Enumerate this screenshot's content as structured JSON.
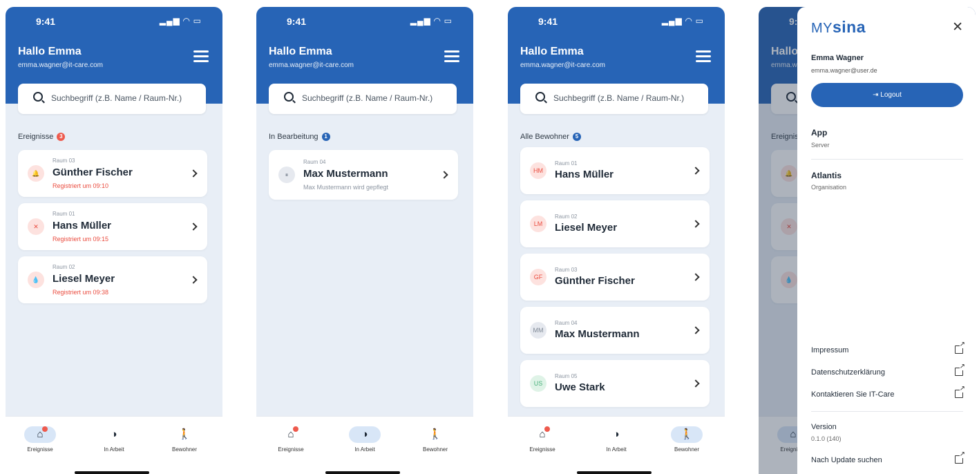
{
  "status": {
    "time": "9:41",
    "system_icons": "signal-wifi-battery"
  },
  "header": {
    "greeting": "Hallo Emma",
    "email": "emma.wagner@it-care.com",
    "menu_icon": "hamburger-menu-icon"
  },
  "search": {
    "placeholder": "Suchbegriff (z.B. Name / Raum-Nr.)"
  },
  "colors": {
    "primary": "#2764b6",
    "alert": "#ea4c3f",
    "background": "#e8eef6"
  },
  "screens": [
    {
      "section_title": "Ereignisse",
      "section_count": "3",
      "cards": [
        {
          "room": "Raum 03",
          "name": "Günther Fischer",
          "sub": "Registriert um 09:10",
          "icon": "alarm-bell-icon"
        },
        {
          "room": "Raum 01",
          "name": "Hans Müller",
          "sub": "Registriert um 09:15",
          "icon": "fall-person-icon"
        },
        {
          "room": "Raum 02",
          "name": "Liesel Meyer",
          "sub": "Registriert um 09:38",
          "icon": "water-drop-icon"
        }
      ]
    },
    {
      "section_title": "In Bearbeitung",
      "section_count": "1",
      "cards": [
        {
          "room": "Raum 04",
          "name": "Max Mustermann",
          "sub": "Max Mustermann wird gepflegt",
          "icon": "pause-icon"
        }
      ]
    },
    {
      "section_title": "Alle Bewohner",
      "section_count": "5",
      "cards": [
        {
          "room": "Raum 01",
          "name": "Hans Müller",
          "initials": "HM"
        },
        {
          "room": "Raum 02",
          "name": "Liesel Meyer",
          "initials": "LM"
        },
        {
          "room": "Raum 03",
          "name": "Günther Fischer",
          "initials": "GF"
        },
        {
          "room": "Raum 04",
          "name": "Max Mustermann",
          "initials": "MM"
        },
        {
          "room": "Raum 05",
          "name": "Uwe Stark",
          "initials": "US"
        }
      ]
    }
  ],
  "tabs": [
    {
      "label": "Ereignisse",
      "icon": "house-alert-icon"
    },
    {
      "label": "In Arbeit",
      "icon": "half-circle-icon"
    },
    {
      "label": "Bewohner",
      "icon": "walking-person-icon"
    }
  ],
  "drawer": {
    "logo_prefix": "MY",
    "logo_bold": "sina",
    "user_name": "Emma Wagner",
    "user_email": "emma.wagner@user.de",
    "logout_label": "Logout",
    "app_title": "App",
    "app_sub": "Server",
    "org_title": "Atlantis",
    "org_sub": "Organisation",
    "links": [
      "Impressum",
      "Datenschutzerklärung",
      "Kontaktieren Sie IT-Care"
    ],
    "version_title": "Version",
    "version_value": "0.1.0 (140)",
    "update_label": "Nach Update suchen"
  }
}
